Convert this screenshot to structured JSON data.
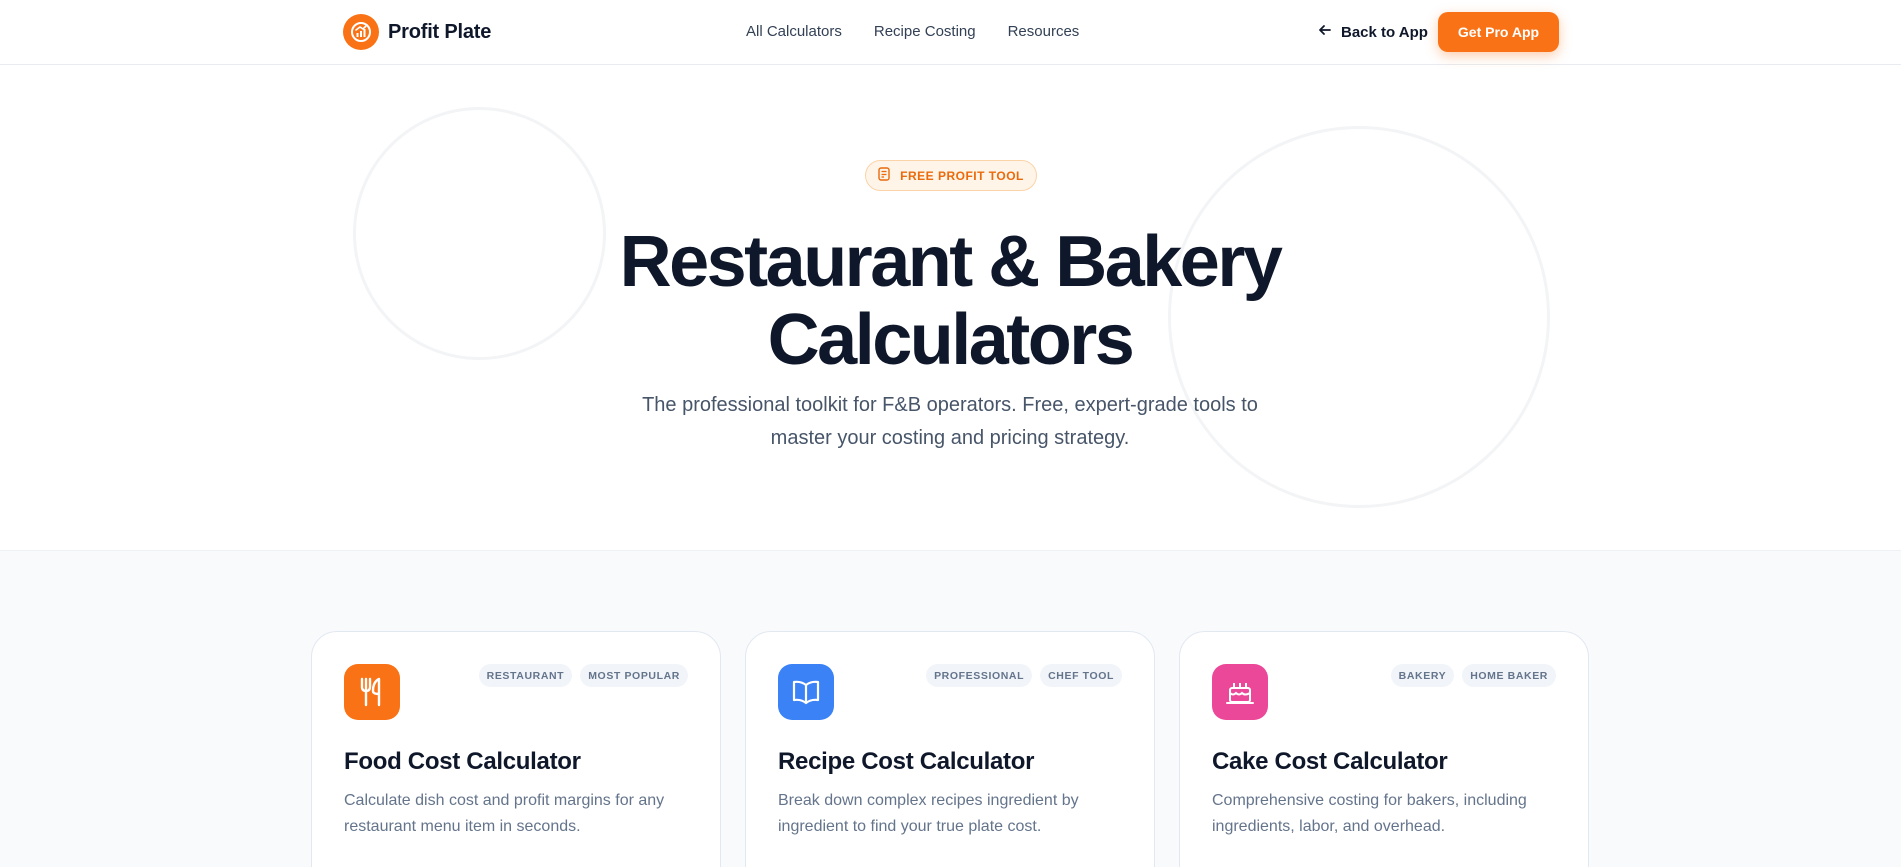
{
  "nav": {
    "brand": "Profit Plate",
    "links": [
      "All Calculators",
      "Recipe Costing",
      "Resources"
    ],
    "back_label": "Back to App",
    "cta_label": "Get Pro App"
  },
  "hero": {
    "badge": "FREE PROFIT TOOL",
    "title_line1": "Restaurant & Bakery",
    "title_line2": "Calculators",
    "subtitle_line1": "The professional toolkit for F&B operators. Free, expert-grade tools to",
    "subtitle_line2": "master your costing and pricing strategy."
  },
  "cards": [
    {
      "icon": "utensils-icon",
      "color": "#f97316",
      "tags": [
        "RESTAURANT",
        "MOST POPULAR"
      ],
      "title": "Food Cost Calculator",
      "desc_line1": "Calculate dish cost and profit margins for any",
      "desc_line2": "restaurant menu item in seconds."
    },
    {
      "icon": "book-open-icon",
      "color": "#3b82f6",
      "tags": [
        "PROFESSIONAL",
        "CHEF TOOL"
      ],
      "title": "Recipe Cost Calculator",
      "desc_line1": "Break down complex recipes ingredient by",
      "desc_line2": "ingredient to find your true plate cost."
    },
    {
      "icon": "cake-icon",
      "color": "#ec4899",
      "tags": [
        "BAKERY",
        "HOME BAKER"
      ],
      "title": "Cake Cost Calculator",
      "desc_line1": "Comprehensive costing for bakers, including",
      "desc_line2": "ingredients, labor, and overhead."
    }
  ],
  "colors": {
    "accent": "#f97316",
    "text": "#0f172a",
    "muted": "#64748b"
  }
}
